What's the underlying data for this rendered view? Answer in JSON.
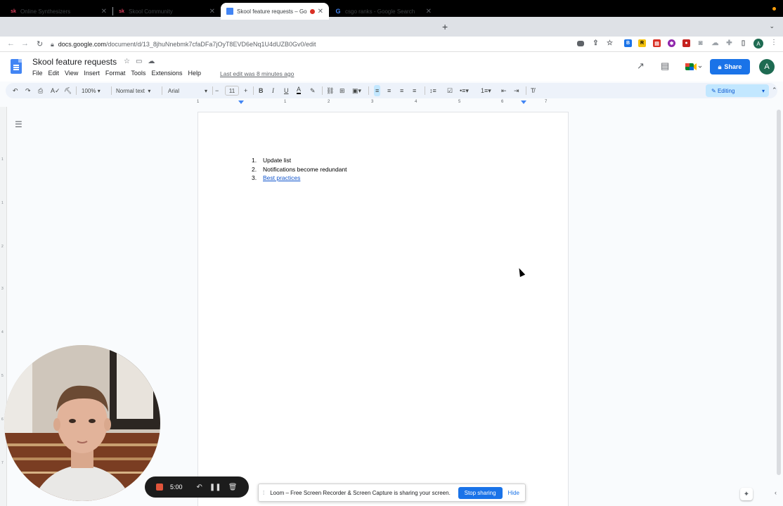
{
  "tabs": [
    {
      "title": "Online Synthesizers",
      "favicon": "sk"
    },
    {
      "title": "Skool Community",
      "favicon": "sk"
    },
    {
      "title": "Skool feature requests – Go",
      "favicon": "docs",
      "active": true
    },
    {
      "title": "csgo ranks - Google Search",
      "favicon": "G"
    }
  ],
  "address": {
    "host": "docs.google.com",
    "path": "/document/d/13_8jhuNnebmk7cfaDFa7jOyT8EVD6eNq1U4dUZB0Gv0/edit"
  },
  "doc": {
    "title": "Skool feature requests",
    "menu": [
      "File",
      "Edit",
      "View",
      "Insert",
      "Format",
      "Tools",
      "Extensions",
      "Help"
    ],
    "last_edit": "Last edit was 8 minutes ago",
    "share_label": "Share",
    "avatar_letter": "A"
  },
  "toolbar": {
    "zoom": "100%",
    "style": "Normal text",
    "font": "Arial",
    "font_size": "11",
    "mode": "Editing"
  },
  "ruler": [
    "1",
    "1",
    "2",
    "3",
    "4",
    "5",
    "6",
    "7"
  ],
  "list": [
    {
      "num": "1.",
      "text": "Update list",
      "link": false
    },
    {
      "num": "2.",
      "text": "Notifications become redundant",
      "link": false
    },
    {
      "num": "3.",
      "text": "Best practices",
      "link": true
    }
  ],
  "loom": {
    "timer": "5:00"
  },
  "share_bar": {
    "message": "Loom – Free Screen Recorder & Screen Capture is sharing your screen.",
    "stop_label": "Stop sharing",
    "hide_label": "Hide"
  },
  "colors": {
    "accent": "#1a73e8",
    "record": "#e0543b",
    "toolbar_bg": "#edf2fa"
  }
}
